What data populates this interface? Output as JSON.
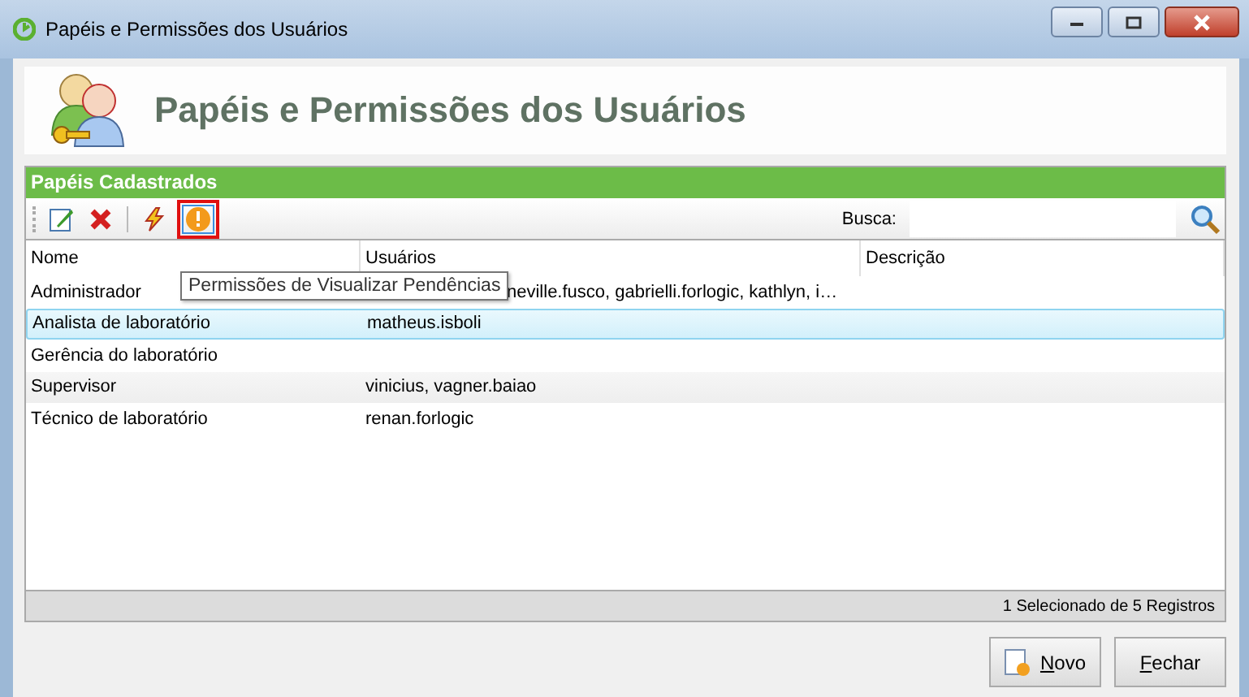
{
  "window": {
    "title": "Papéis e Permissões dos Usuários"
  },
  "header": {
    "title": "Papéis e Permissões dos Usuários"
  },
  "panel": {
    "title": "Papéis Cadastrados"
  },
  "toolbar": {
    "search_label": "Busca:",
    "tools": [
      {
        "kind": "edit",
        "highlighted": false
      },
      {
        "kind": "delete",
        "highlighted": false
      },
      {
        "kind": "lightning",
        "highlighted": false
      },
      {
        "kind": "warning",
        "highlighted": true
      }
    ]
  },
  "tooltip": "Permissões de Visualizar Pendências",
  "table": {
    "columns": [
      "Nome",
      "Usuários",
      "Descrição"
    ],
    "rows": [
      {
        "cells": [
          "Administrador",
          "neville.fusco, gabrielli.forlogic, kathlyn, i…",
          ""
        ],
        "selected": false
      },
      {
        "cells": [
          "Analista de laboratório",
          "matheus.isboli",
          ""
        ],
        "selected": true
      },
      {
        "cells": [
          "Gerência do laboratório",
          "",
          ""
        ],
        "selected": false
      },
      {
        "cells": [
          "Supervisor",
          "vinicius, vagner.baiao",
          ""
        ],
        "selected": false
      },
      {
        "cells": [
          "Técnico de laboratório",
          "renan.forlogic",
          ""
        ],
        "selected": false
      }
    ]
  },
  "status_bar": "1 Selecionado de 5 Registros",
  "buttons": [
    {
      "label": "Novo",
      "first_letter_underlined": true,
      "kind": "new"
    },
    {
      "label": "Fechar",
      "first_letter_underlined": true,
      "kind": "close"
    }
  ]
}
